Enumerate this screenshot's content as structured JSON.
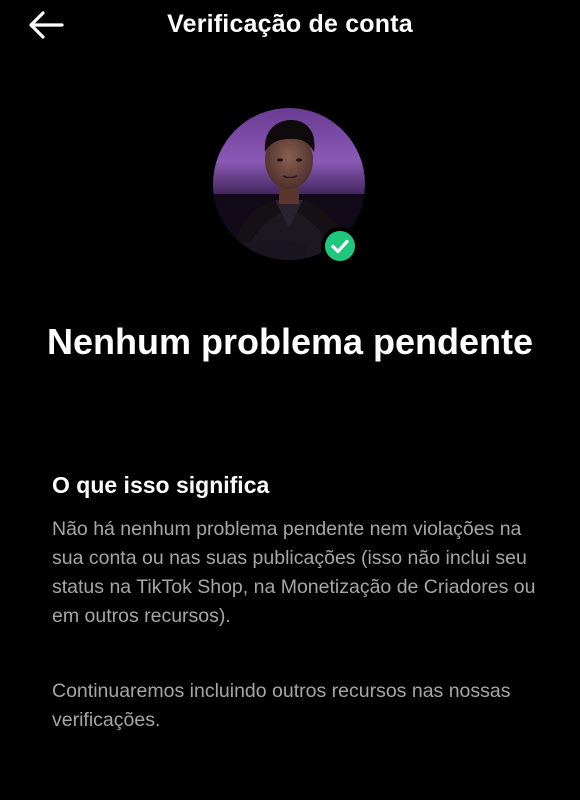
{
  "header": {
    "title": "Verificação de conta",
    "back_icon": "arrow-left-icon"
  },
  "profile": {
    "avatar": "profile-photo",
    "badge_icon": "check-circle-icon",
    "badge_color": "#1fc77d",
    "accent_color": "#7e4ea8"
  },
  "status": {
    "title": "Nenhum problema pendente"
  },
  "details": {
    "heading": "O que isso significa",
    "paragraph_1": "Não há nenhum problema pendente nem violações na sua conta ou nas suas publicações (isso não inclui seu status na TikTok Shop, na Monetização de Criadores ou em outros recursos).",
    "paragraph_2": "Continuaremos incluindo outros recursos nas nossas verificações."
  }
}
